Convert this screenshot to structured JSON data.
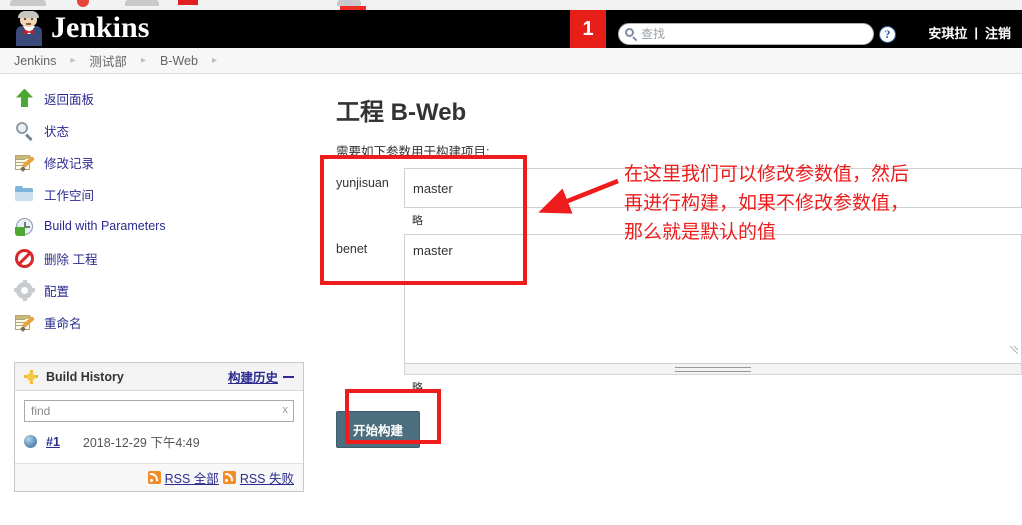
{
  "header": {
    "brand": "Jenkins",
    "badge_count": "1",
    "search_placeholder": "查找",
    "search_value": "",
    "help_label": "?",
    "user_name": "安琪拉",
    "separator": "|",
    "logout_label": "注销",
    "brand_bg": "#000000",
    "badge_bg": "#e81f18"
  },
  "breadcrumb": {
    "separator": "▸",
    "items": [
      {
        "label": "Jenkins"
      },
      {
        "label": "测试部"
      },
      {
        "label": "B-Web"
      }
    ]
  },
  "sidebar": {
    "items": [
      {
        "label": "返回面板",
        "icon": "up-arrow-icon"
      },
      {
        "label": "状态",
        "icon": "magnifier-icon"
      },
      {
        "label": "修改记录",
        "icon": "notepad-pencil-icon"
      },
      {
        "label": "工作空间",
        "icon": "folder-icon"
      },
      {
        "label": "Build with Parameters",
        "icon": "build-params-icon"
      },
      {
        "label": "删除 工程",
        "icon": "no-entry-icon"
      },
      {
        "label": "配置",
        "icon": "gear-icon"
      },
      {
        "label": "重命名",
        "icon": "notepad-pencil-icon"
      }
    ]
  },
  "build_history": {
    "title": "Build History",
    "link_label": "构建历史",
    "find_placeholder": "find",
    "find_value": "",
    "clear_label": "x",
    "builds": [
      {
        "number": "#1",
        "date": "2018-12-29 下午4:49",
        "status": "blue-ball"
      }
    ],
    "rss_all_label": "RSS 全部",
    "rss_failed_label": "RSS 失败"
  },
  "main": {
    "page_title": "工程 B-Web",
    "description": "需要如下参数用于构建项目:",
    "parameters": [
      {
        "name": "yunjisuan",
        "value": "master",
        "description": "略",
        "kind": "input"
      },
      {
        "name": "benet",
        "value": "master",
        "description": "略",
        "kind": "textarea"
      }
    ],
    "build_button_label": "开始构建",
    "build_button_bg": "#4c6e7e"
  },
  "annotations": {
    "color": "#ee1c1c",
    "note_line1": "在这里我们可以修改参数值，然后",
    "note_line2": "再进行构建，如果不修改参数值，",
    "note_line3": "那么就是默认的值"
  }
}
